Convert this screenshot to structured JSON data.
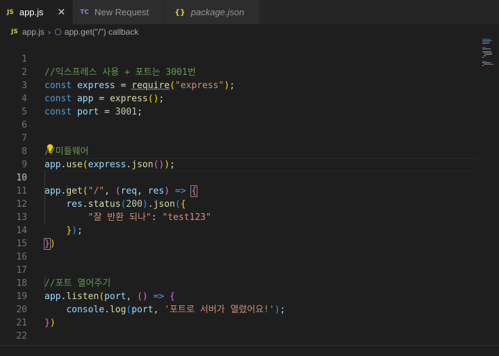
{
  "tabs": [
    {
      "icon": "JS",
      "label": "app.js",
      "close": "✕"
    },
    {
      "icon": "TC",
      "label": "New Request"
    },
    {
      "icon": "{}",
      "label": "package.json"
    }
  ],
  "breadcrumb": {
    "icon": "JS",
    "file": "app.js",
    "symbol": "app.get(\"/\") callback"
  },
  "colors": {
    "comment": "#6a9955",
    "keyword": "#569cd6",
    "variable": "#9cdcfe",
    "function": "#dcdcaa",
    "string": "#ce9178",
    "number": "#b5cea8"
  },
  "editor": {
    "current_line": 10,
    "line_numbers": [
      "1",
      "2",
      "3",
      "4",
      "5",
      "6",
      "7",
      "8",
      "9",
      "10",
      "11",
      "12",
      "13",
      "14",
      "15",
      "16",
      "17",
      "18",
      "19",
      "20",
      "21",
      "22"
    ],
    "lines": {
      "l1": [
        "//익스프레스 사용 + 포트는 3001번"
      ],
      "l2": [
        "const",
        " ",
        "express",
        " = ",
        "require",
        "(",
        "\"express\"",
        ")",
        ";"
      ],
      "l3": [
        "const",
        " ",
        "app",
        " = ",
        "express",
        "(",
        ")",
        ";"
      ],
      "l4": [
        "const",
        " ",
        "port",
        " = ",
        "3001",
        ";"
      ],
      "l7": [
        "//미들웨어"
      ],
      "l8": [
        "app",
        ".",
        "use",
        "(",
        "express",
        ".",
        "json",
        "(",
        ")",
        ")",
        ";"
      ],
      "l10": [
        "app",
        ".",
        "get",
        "(",
        "\"/\"",
        ", ",
        "(",
        "req",
        ", ",
        "res",
        ")",
        " => ",
        "{"
      ],
      "l11": [
        "    ",
        "res",
        ".",
        "status",
        "(",
        "200",
        ")",
        ".",
        "json",
        "(",
        "{"
      ],
      "l12": [
        "        ",
        "\"잘 반환 되나\"",
        ": ",
        "\"test123\""
      ],
      "l13": [
        "    ",
        "}",
        ")",
        ";"
      ],
      "l14": [
        "}",
        ")"
      ],
      "l17": [
        "//포트 열어주기"
      ],
      "l18": [
        "app",
        ".",
        "listen",
        "(",
        "port",
        ", ",
        "(",
        ")",
        " => ",
        "{"
      ],
      "l19": [
        "    ",
        "console",
        ".",
        "log",
        "(",
        "port",
        ", ",
        "'포트로 서버가 열렸어요!'",
        ")",
        ";"
      ],
      "l20": [
        "}",
        ")"
      ]
    }
  }
}
